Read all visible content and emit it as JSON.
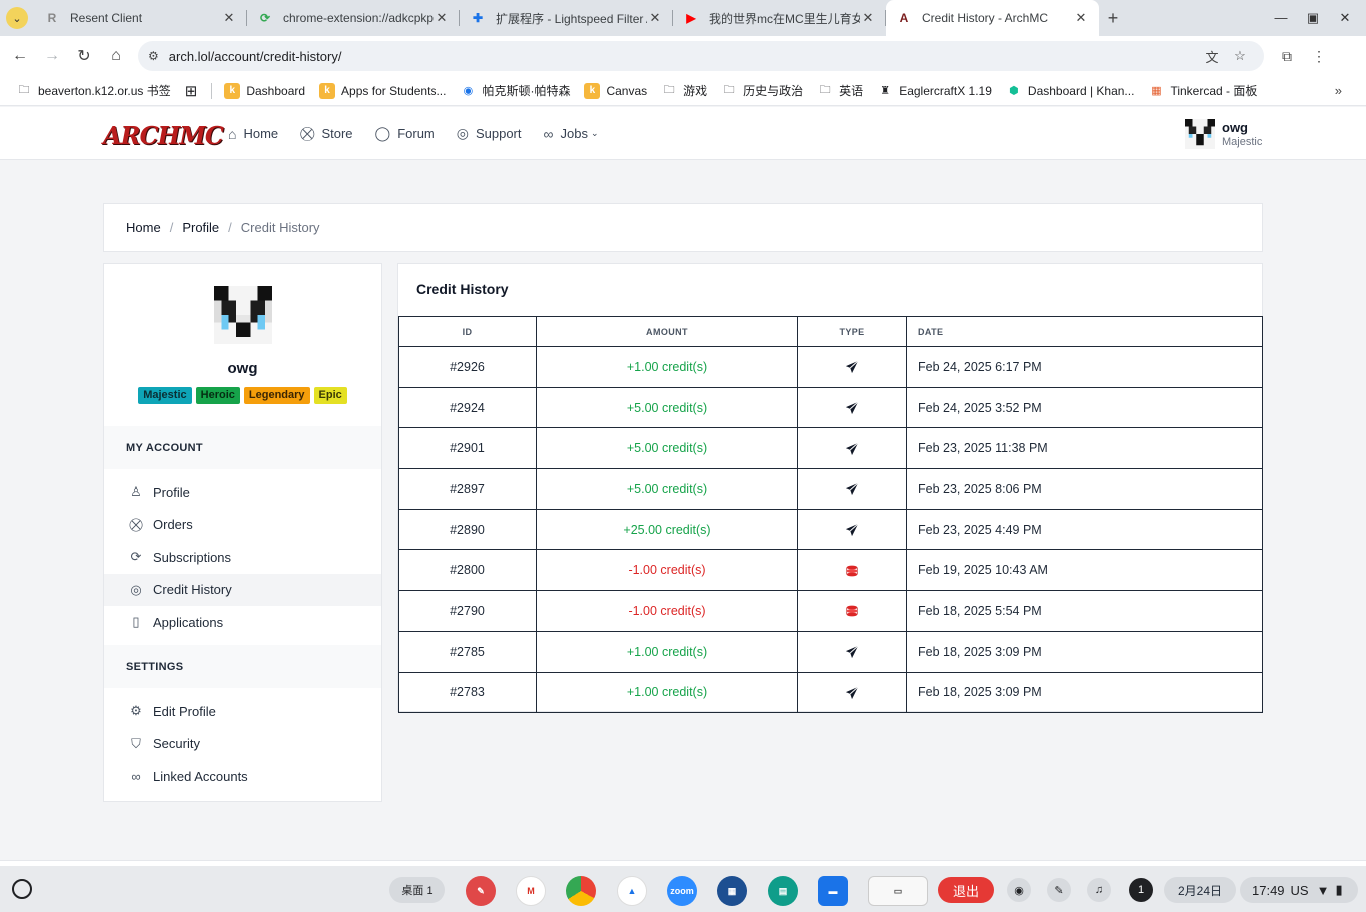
{
  "browser": {
    "tabs": [
      {
        "label": "Resent Client",
        "favicon": "R",
        "active": false
      },
      {
        "label": "chrome-extension://adkcpkpg",
        "favicon": "ext",
        "active": false
      },
      {
        "label": "扩展程序 - Lightspeed Filter A",
        "favicon": "puzzle",
        "active": false
      },
      {
        "label": "我的世界mc在MC里生儿育女",
        "favicon": "youtube",
        "active": false
      },
      {
        "label": "Credit History - ArchMC",
        "favicon": "archmc",
        "active": true
      }
    ],
    "url": "arch.lol/account/credit-history/",
    "bookmarks": [
      {
        "label": "beaverton.k12.or.us 书签",
        "icon": "folder-icon"
      },
      {
        "label": "Dashboard",
        "icon": "k"
      },
      {
        "label": "Apps for Students...",
        "icon": "k"
      },
      {
        "label": "帕克斯顿·帕特森",
        "icon": "chrome"
      },
      {
        "label": "Canvas",
        "icon": "k"
      },
      {
        "label": "游戏",
        "icon": "folder"
      },
      {
        "label": "历史与政治",
        "icon": "folder"
      },
      {
        "label": "英语",
        "icon": "folder"
      },
      {
        "label": "EaglercraftX 1.19",
        "icon": "eagler"
      },
      {
        "label": "Dashboard | Khan...",
        "icon": "khan"
      },
      {
        "label": "Tinkercad - 面板",
        "icon": "tinker"
      }
    ]
  },
  "site": {
    "logo": "ARCHMC",
    "nav": [
      {
        "label": "Home",
        "icon": "home-icon"
      },
      {
        "label": "Store",
        "icon": "cart-icon"
      },
      {
        "label": "Forum",
        "icon": "chat-icon"
      },
      {
        "label": "Support",
        "icon": "lifebuoy-icon"
      },
      {
        "label": "Jobs",
        "icon": "link-icon"
      }
    ],
    "user": {
      "name": "owg",
      "rank": "Majestic"
    }
  },
  "breadcrumb": {
    "home": "Home",
    "profile": "Profile",
    "current": "Credit History"
  },
  "sidebar": {
    "username": "owg",
    "ranks": [
      {
        "label": "Majestic",
        "bg": "#0ea5b7",
        "fg": "#0b2e33"
      },
      {
        "label": "Heroic",
        "bg": "#16a34a",
        "fg": "#052e12"
      },
      {
        "label": "Legendary",
        "bg": "#f59e0b",
        "fg": "#3b2503"
      },
      {
        "label": "Epic",
        "bg": "#e4e024",
        "fg": "#3a3a05"
      }
    ],
    "account_title": "MY ACCOUNT",
    "account_items": [
      {
        "label": "Profile",
        "icon": "user-icon"
      },
      {
        "label": "Orders",
        "icon": "cart-icon"
      },
      {
        "label": "Subscriptions",
        "icon": "refresh-icon"
      },
      {
        "label": "Credit History",
        "icon": "coins-icon"
      },
      {
        "label": "Applications",
        "icon": "document-icon"
      }
    ],
    "settings_title": "SETTINGS",
    "settings_items": [
      {
        "label": "Edit Profile",
        "icon": "gear-icon"
      },
      {
        "label": "Security",
        "icon": "shield-icon"
      },
      {
        "label": "Linked Accounts",
        "icon": "link-icon"
      }
    ]
  },
  "credit_history": {
    "title": "Credit History",
    "columns": {
      "id": "ID",
      "amount": "AMOUNT",
      "type": "TYPE",
      "date": "DATE"
    },
    "rows": [
      {
        "id": "#2926",
        "amount": "+1.00 credit(s)",
        "sign": "positive",
        "type": "send",
        "date": "Feb 24, 2025 6:17 PM"
      },
      {
        "id": "#2924",
        "amount": "+5.00 credit(s)",
        "sign": "positive",
        "type": "send",
        "date": "Feb 24, 2025 3:52 PM"
      },
      {
        "id": "#2901",
        "amount": "+5.00 credit(s)",
        "sign": "positive",
        "type": "send",
        "date": "Feb 23, 2025 11:38 PM"
      },
      {
        "id": "#2897",
        "amount": "+5.00 credit(s)",
        "sign": "positive",
        "type": "send",
        "date": "Feb 23, 2025 8:06 PM"
      },
      {
        "id": "#2890",
        "amount": "+25.00 credit(s)",
        "sign": "positive",
        "type": "send",
        "date": "Feb 23, 2025 4:49 PM"
      },
      {
        "id": "#2800",
        "amount": "-1.00 credit(s)",
        "sign": "negative",
        "type": "coins",
        "date": "Feb 19, 2025 10:43 AM"
      },
      {
        "id": "#2790",
        "amount": "-1.00 credit(s)",
        "sign": "negative",
        "type": "coins",
        "date": "Feb 18, 2025 5:54 PM"
      },
      {
        "id": "#2785",
        "amount": "+1.00 credit(s)",
        "sign": "positive",
        "type": "send",
        "date": "Feb 18, 2025 3:09 PM"
      },
      {
        "id": "#2783",
        "amount": "+1.00 credit(s)",
        "sign": "positive",
        "type": "send",
        "date": "Feb 18, 2025 3:09 PM"
      }
    ]
  },
  "shelf": {
    "desk": "桌面 1",
    "exit": "退出",
    "notification_count": "1",
    "date": "2月24日",
    "time": "17:49",
    "locale": "US"
  },
  "colors": {
    "positive": "#16a34a",
    "negative": "#dc2626",
    "brand": "#b91c1c"
  }
}
